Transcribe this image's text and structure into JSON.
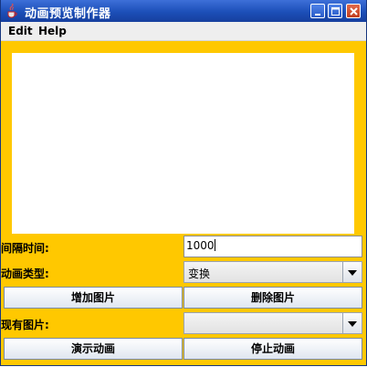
{
  "window": {
    "title": "动画预览制作器"
  },
  "menu": {
    "items": [
      "Edit",
      "Help"
    ]
  },
  "form": {
    "interval_label": "间隔时间:",
    "interval_value": "1000",
    "anim_type_label": "动画类型:",
    "anim_type_value": "变换",
    "current_images_label": "现有图片:",
    "current_images_value": ""
  },
  "buttons": {
    "add_image": "增加图片",
    "delete_image": "删除图片",
    "play": "演示动画",
    "stop": "停止动画"
  }
}
